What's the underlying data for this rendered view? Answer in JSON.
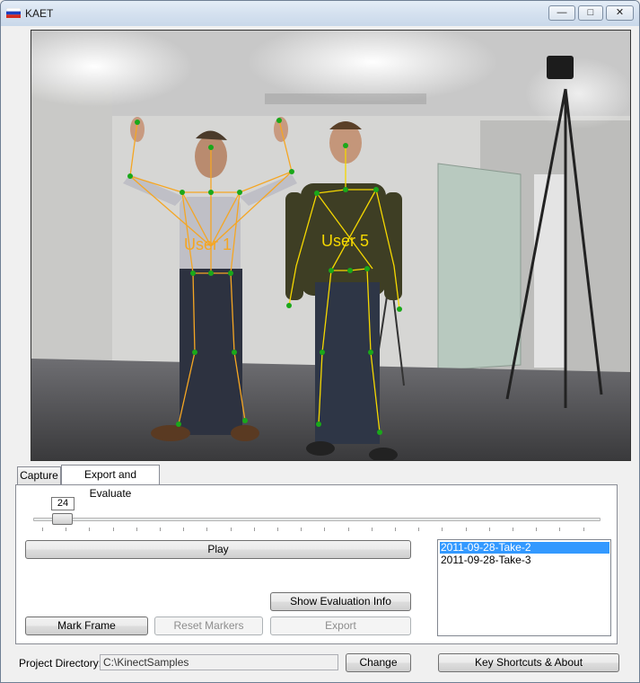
{
  "window": {
    "title": "KAET",
    "minimize_glyph": "—",
    "maximize_glyph": "□",
    "close_glyph": "✕"
  },
  "video": {
    "user_labels": [
      "User 1",
      "User 5"
    ],
    "colors": {
      "skeleton_1": "#f5a623",
      "skeleton_2": "#f5d800",
      "joint": "#1aa81a"
    }
  },
  "tabs": [
    {
      "label": "Capture",
      "active": false
    },
    {
      "label": "Export and Evaluate",
      "active": true
    }
  ],
  "slider": {
    "value": "24",
    "fraction": 0.05
  },
  "buttons": {
    "play": "Play",
    "show_eval": "Show Evaluation Info",
    "mark_frame": "Mark Frame",
    "reset_markers": "Reset Markers",
    "export": "Export",
    "change": "Change",
    "shortcuts": "Key Shortcuts & About"
  },
  "takes": [
    {
      "label": "2011-09-28-Take-2",
      "selected": true
    },
    {
      "label": "2011-09-28-Take-3",
      "selected": false
    }
  ],
  "project": {
    "label": "Project Directory:",
    "path": "C:\\KinectSamples"
  }
}
